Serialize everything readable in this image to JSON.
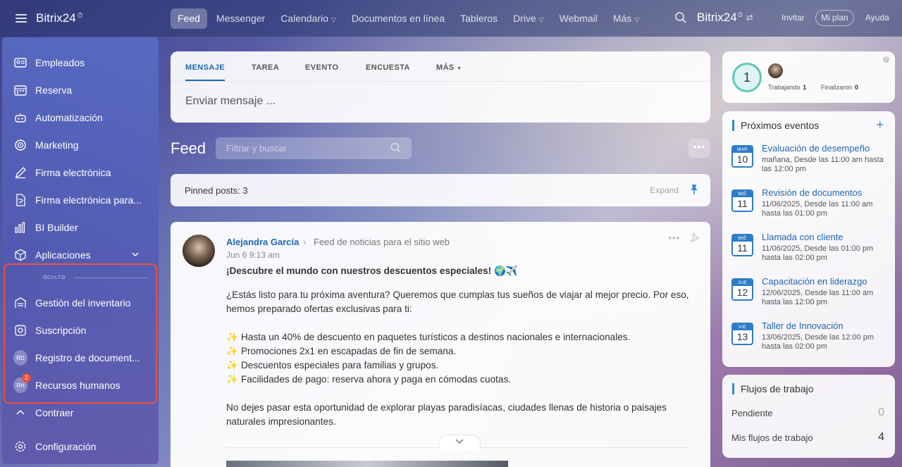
{
  "app": {
    "brand": "Bitrix24",
    "brand_mark": "⏱"
  },
  "topnav": {
    "tabs": [
      {
        "label": "Feed",
        "active": true,
        "has_caret": false
      },
      {
        "label": "Messenger",
        "has_caret": false
      },
      {
        "label": "Calendario",
        "has_caret": true
      },
      {
        "label": "Documentos en línea",
        "has_caret": false
      },
      {
        "label": "Tableros",
        "has_caret": false
      },
      {
        "label": "Drive",
        "has_caret": true
      },
      {
        "label": "Webmail",
        "has_caret": false
      },
      {
        "label": "Más",
        "has_caret": true
      }
    ],
    "brand_right": "Bitrix24",
    "invite": "Invitar",
    "my_plan": "Mi plan",
    "help": "Ayuda"
  },
  "sidebar": {
    "items": [
      {
        "label": "Empleados",
        "icon": "employees-icon"
      },
      {
        "label": "Reserva",
        "icon": "calendar-grid-icon"
      },
      {
        "label": "Automatización",
        "icon": "robot-icon"
      },
      {
        "label": "Marketing",
        "icon": "target-icon"
      },
      {
        "label": "Firma electrónica",
        "icon": "pen-icon"
      },
      {
        "label": "Firma electrónica para...",
        "icon": "document-sign-icon"
      },
      {
        "label": "BI Builder",
        "icon": "bar-chart-icon"
      },
      {
        "label": "Aplicaciones",
        "icon": "cube-icon"
      }
    ],
    "hidden_label": "OCULTO",
    "hidden_items": [
      {
        "label": "Gestión del inventario",
        "icon": "warehouse-icon"
      },
      {
        "label": "Suscripción",
        "icon": "subscription-icon"
      },
      {
        "label": "Registro de document...",
        "initials": "RD"
      },
      {
        "label": "Recursos humanos",
        "initials": "RH",
        "badge": "2"
      }
    ],
    "collapse": "Contraer",
    "settings": "Configuración"
  },
  "composer": {
    "tabs": [
      "MENSAJE",
      "TAREA",
      "EVENTO",
      "ENCUESTA",
      "MÁS"
    ],
    "placeholder": "Enviar mensaje ..."
  },
  "feed": {
    "title": "Feed",
    "search_placeholder": "Filtrar y buscar",
    "pinned_label": "Pinned posts: 3",
    "expand": "Expand"
  },
  "post": {
    "author": "Alejandra García",
    "destination": "Feed de noticias para el sitio web",
    "date": "Jun 6 9:13 am",
    "title": "¡Descubre el mundo con nuestros descuentos especiales! 🌍✈️",
    "intro": "¿Estás listo para tu próxima aventura? Queremos que cumplas tus sueños de viajar al mejor precio. Por eso, hemos preparado ofertas exclusivas para ti:",
    "bullets": [
      "Hasta un 40% de descuento en paquetes turísticos a destinos nacionales e internacionales.",
      "Promociones 2x1 en escapadas de fin de semana.",
      "Descuentos especiales para familias y grupos.",
      "Facilidades de pago: reserva ahora y paga en cómodas cuotas."
    ],
    "closing": "No dejes pasar esta oportunidad de explorar playas paradisíacas, ciudades llenas de historia o paisajes naturales impresionantes."
  },
  "worktime": {
    "count": "1",
    "working_label": "Trabajando",
    "working_value": "1",
    "finished_label": "Finalizaron",
    "finished_value": "0"
  },
  "events": {
    "title": "Próximos eventos",
    "items": [
      {
        "month": "MAR",
        "day": "10",
        "name": "Evaluación de desempeño",
        "when": "mañana, Desde las 11:00 am hasta las 12:00 pm"
      },
      {
        "month": "MIÉ",
        "day": "11",
        "name": "Revisión de documentos",
        "when": "11/06/2025, Desde las 11:00 am hasta las 01:00 pm"
      },
      {
        "month": "MIÉ",
        "day": "11",
        "name": "Llamada con cliente",
        "when": "11/06/2025, Desde las 01:00 pm hasta las 02:00 pm"
      },
      {
        "month": "JUE",
        "day": "12",
        "name": "Capacitación en liderazgo",
        "when": "12/06/2025, Desde las 11:00 am hasta las 12:00 pm"
      },
      {
        "month": "VIE",
        "day": "13",
        "name": "Taller de Innovación",
        "when": "13/06/2025, Desde las 12:00 pm hasta las 02:00 pm"
      }
    ]
  },
  "workflows": {
    "title": "Flujos de trabajo",
    "pending_label": "Pendiente",
    "pending_value": "0",
    "mine_label": "Mis flujos de trabajo",
    "mine_value": "4"
  },
  "colors": {
    "accent": "#2067b0",
    "highlight": "#e8523f",
    "badge": "#e8523f"
  }
}
